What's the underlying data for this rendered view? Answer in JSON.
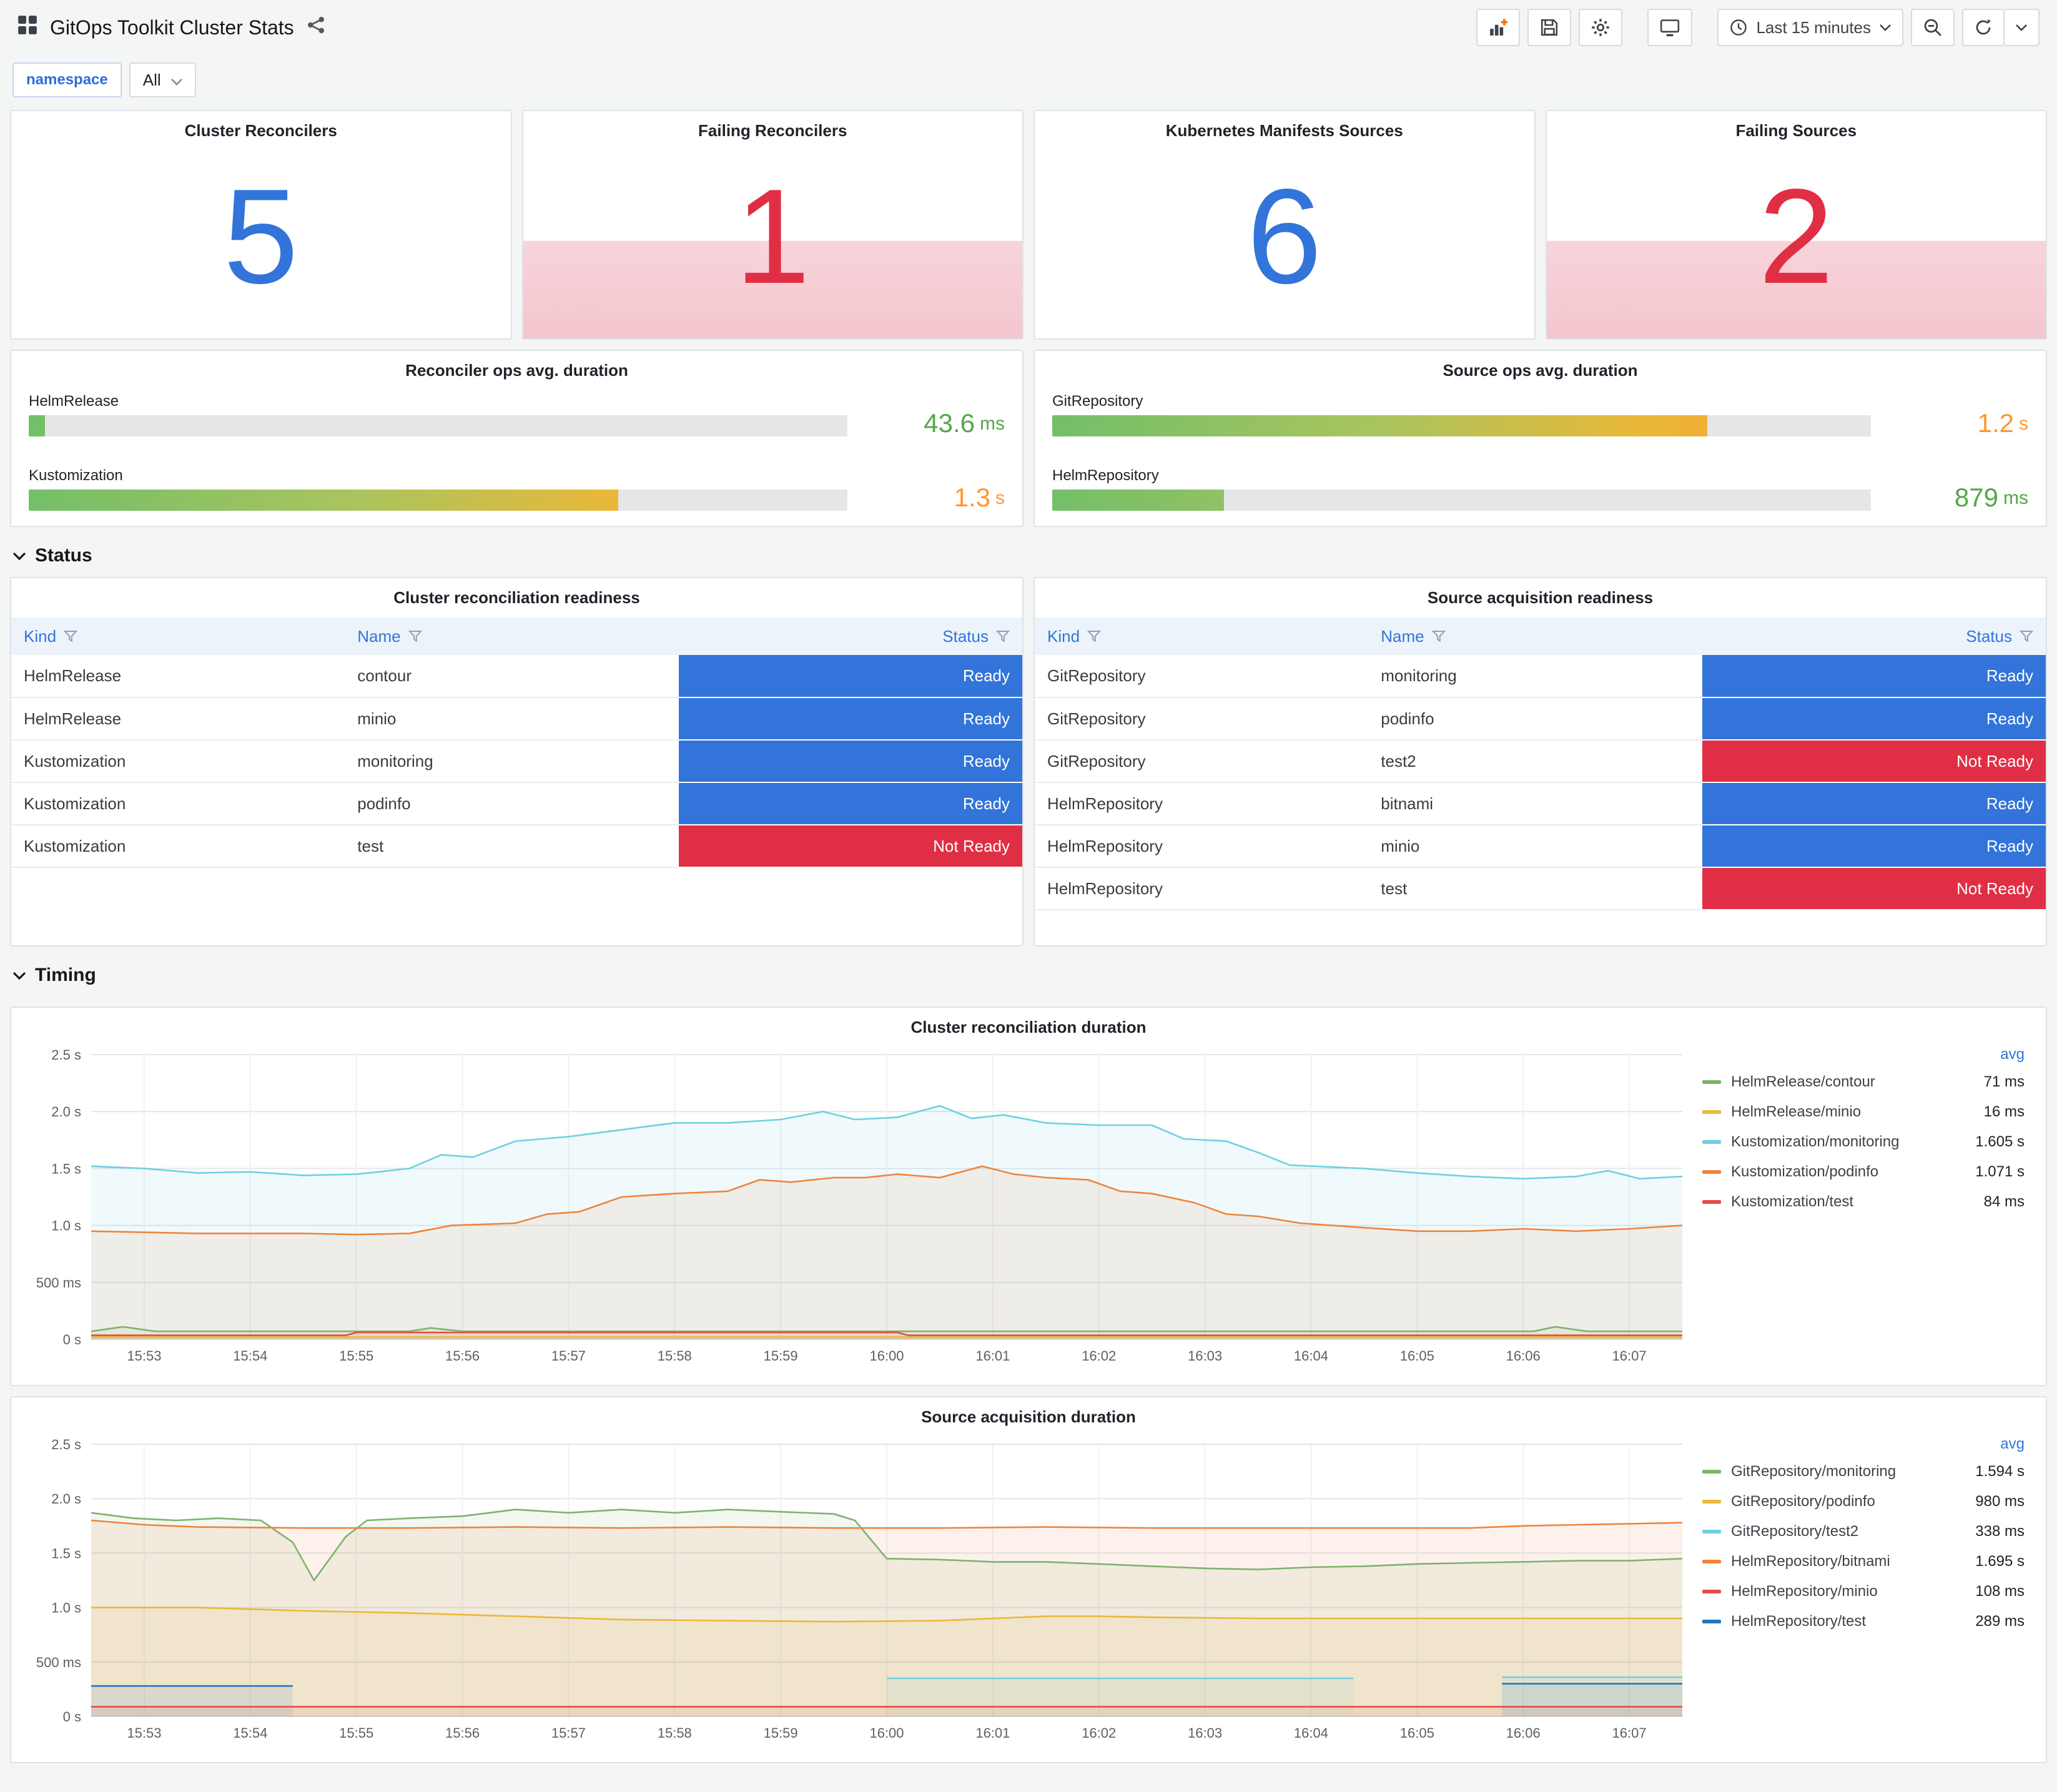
{
  "header": {
    "title": "GitOps Toolkit Cluster Stats",
    "time_range": "Last 15 minutes"
  },
  "variables": {
    "label": "namespace",
    "value": "All"
  },
  "icons": {
    "apps-icon": "grid",
    "share-icon": "share-nodes",
    "add-panel-icon": "graph-plus",
    "save-icon": "floppy-disk",
    "settings-icon": "gear",
    "tv-icon": "monitor",
    "clock-icon": "clock",
    "caret-down-icon": "chevron-down",
    "zoom-out-icon": "magnifier-minus",
    "refresh-icon": "circular-arrow",
    "filter-icon": "funnel",
    "collapse-icon": "chevron-down"
  },
  "rows": {
    "status": "Status",
    "timing": "Timing"
  },
  "stats": [
    {
      "title": "Cluster Reconcilers",
      "value": "5",
      "color": "#3274D9",
      "alert": false
    },
    {
      "title": "Failing Reconcilers",
      "value": "1",
      "color": "#E02F44",
      "alert": true
    },
    {
      "title": "Kubernetes Manifests Sources",
      "value": "6",
      "color": "#3274D9",
      "alert": false
    },
    {
      "title": "Failing Sources",
      "value": "2",
      "color": "#E02F44",
      "alert": true
    }
  ],
  "gauges": [
    {
      "title": "Reconciler ops avg. duration",
      "bars": [
        {
          "label": "HelmRelease",
          "value": "43.6",
          "unit": "ms",
          "percent": 2,
          "value_color": "#56A64B"
        },
        {
          "label": "Kustomization",
          "value": "1.3",
          "unit": "s",
          "percent": 72,
          "value_color": "#FF9830"
        }
      ]
    },
    {
      "title": "Source ops avg. duration",
      "bars": [
        {
          "label": "GitRepository",
          "value": "1.2",
          "unit": "s",
          "percent": 80,
          "value_color": "#FF9830"
        },
        {
          "label": "HelmRepository",
          "value": "879",
          "unit": "ms",
          "percent": 21,
          "value_color": "#56A64B"
        }
      ]
    }
  ],
  "status_colors": {
    "Ready": "#3274D9",
    "Not Ready": "#E02F44"
  },
  "tables": [
    {
      "title": "Cluster reconciliation readiness",
      "columns": [
        "Kind",
        "Name",
        "Status"
      ],
      "rows": [
        {
          "kind": "HelmRelease",
          "name": "contour",
          "status": "Ready"
        },
        {
          "kind": "HelmRelease",
          "name": "minio",
          "status": "Ready"
        },
        {
          "kind": "Kustomization",
          "name": "monitoring",
          "status": "Ready"
        },
        {
          "kind": "Kustomization",
          "name": "podinfo",
          "status": "Ready"
        },
        {
          "kind": "Kustomization",
          "name": "test",
          "status": "Not Ready"
        }
      ]
    },
    {
      "title": "Source acquisition readiness",
      "columns": [
        "Kind",
        "Name",
        "Status"
      ],
      "rows": [
        {
          "kind": "GitRepository",
          "name": "monitoring",
          "status": "Ready"
        },
        {
          "kind": "GitRepository",
          "name": "podinfo",
          "status": "Ready"
        },
        {
          "kind": "GitRepository",
          "name": "test2",
          "status": "Not Ready"
        },
        {
          "kind": "HelmRepository",
          "name": "bitnami",
          "status": "Ready"
        },
        {
          "kind": "HelmRepository",
          "name": "minio",
          "status": "Ready"
        },
        {
          "kind": "HelmRepository",
          "name": "test",
          "status": "Not Ready"
        }
      ]
    }
  ],
  "chart_data": [
    {
      "type": "line",
      "title": "Cluster reconciliation duration",
      "legend_header": "avg",
      "ylim": [
        0,
        2.5
      ],
      "x_range_minutes": [
        0,
        15
      ],
      "x_ticks": [
        "15:53",
        "15:54",
        "15:55",
        "15:56",
        "15:57",
        "15:58",
        "15:59",
        "16:00",
        "16:01",
        "16:02",
        "16:03",
        "16:04",
        "16:05",
        "16:06",
        "16:07"
      ],
      "y_ticks": [
        {
          "v": 0,
          "label": "0 s"
        },
        {
          "v": 0.5,
          "label": "500 ms"
        },
        {
          "v": 1.0,
          "label": "1.0 s"
        },
        {
          "v": 1.5,
          "label": "1.5 s"
        },
        {
          "v": 2.0,
          "label": "2.0 s"
        },
        {
          "v": 2.5,
          "label": "2.5 s"
        }
      ],
      "series": [
        {
          "name": "HelmRelease/contour",
          "avg": "71 ms",
          "color": "#7EB26D",
          "points": [
            [
              0,
              0.07
            ],
            [
              0.3,
              0.11
            ],
            [
              0.6,
              0.07
            ],
            [
              3,
              0.07
            ],
            [
              3.2,
              0.1
            ],
            [
              3.5,
              0.07
            ],
            [
              9,
              0.07
            ],
            [
              13.6,
              0.07
            ],
            [
              13.8,
              0.11
            ],
            [
              14.1,
              0.07
            ],
            [
              15,
              0.07
            ]
          ]
        },
        {
          "name": "HelmRelease/minio",
          "avg": "16 ms",
          "color": "#EAB839",
          "points": [
            [
              0,
              0.02
            ],
            [
              15,
              0.02
            ]
          ]
        },
        {
          "name": "Kustomization/monitoring",
          "avg": "1.605 s",
          "color": "#6ED0E0",
          "points": [
            [
              0,
              1.52
            ],
            [
              0.5,
              1.5
            ],
            [
              1,
              1.46
            ],
            [
              1.5,
              1.47
            ],
            [
              2,
              1.44
            ],
            [
              2.5,
              1.45
            ],
            [
              3,
              1.5
            ],
            [
              3.3,
              1.62
            ],
            [
              3.6,
              1.6
            ],
            [
              4,
              1.74
            ],
            [
              4.5,
              1.78
            ],
            [
              5,
              1.84
            ],
            [
              5.5,
              1.9
            ],
            [
              6,
              1.9
            ],
            [
              6.5,
              1.93
            ],
            [
              6.9,
              2.0
            ],
            [
              7.2,
              1.93
            ],
            [
              7.6,
              1.95
            ],
            [
              8,
              2.05
            ],
            [
              8.3,
              1.94
            ],
            [
              8.6,
              1.97
            ],
            [
              9,
              1.9
            ],
            [
              9.5,
              1.88
            ],
            [
              10,
              1.88
            ],
            [
              10.3,
              1.76
            ],
            [
              10.7,
              1.74
            ],
            [
              11,
              1.64
            ],
            [
              11.3,
              1.53
            ],
            [
              12,
              1.5
            ],
            [
              12.5,
              1.46
            ],
            [
              13,
              1.43
            ],
            [
              13.5,
              1.41
            ],
            [
              14,
              1.43
            ],
            [
              14.3,
              1.48
            ],
            [
              14.6,
              1.41
            ],
            [
              15,
              1.43
            ]
          ]
        },
        {
          "name": "Kustomization/podinfo",
          "avg": "1.071 s",
          "color": "#EF843C",
          "points": [
            [
              0,
              0.95
            ],
            [
              1,
              0.93
            ],
            [
              2,
              0.93
            ],
            [
              2.5,
              0.92
            ],
            [
              3,
              0.93
            ],
            [
              3.4,
              1.0
            ],
            [
              4,
              1.02
            ],
            [
              4.3,
              1.1
            ],
            [
              4.6,
              1.12
            ],
            [
              5,
              1.25
            ],
            [
              5.5,
              1.28
            ],
            [
              6,
              1.3
            ],
            [
              6.3,
              1.4
            ],
            [
              6.6,
              1.38
            ],
            [
              7,
              1.42
            ],
            [
              7.3,
              1.42
            ],
            [
              7.6,
              1.45
            ],
            [
              8,
              1.42
            ],
            [
              8.4,
              1.52
            ],
            [
              8.7,
              1.45
            ],
            [
              9,
              1.42
            ],
            [
              9.4,
              1.4
            ],
            [
              9.7,
              1.3
            ],
            [
              10,
              1.28
            ],
            [
              10.4,
              1.2
            ],
            [
              10.7,
              1.1
            ],
            [
              11,
              1.08
            ],
            [
              11.4,
              1.02
            ],
            [
              12,
              0.98
            ],
            [
              12.5,
              0.95
            ],
            [
              13,
              0.95
            ],
            [
              13.5,
              0.97
            ],
            [
              14,
              0.95
            ],
            [
              14.5,
              0.97
            ],
            [
              15,
              1.0
            ]
          ]
        },
        {
          "name": "Kustomization/test",
          "avg": "84 ms",
          "color": "#E24D42",
          "points": [
            [
              0,
              0.035
            ],
            [
              2.4,
              0.035
            ],
            [
              2.5,
              0.06
            ],
            [
              7.6,
              0.06
            ],
            [
              7.7,
              0.035
            ],
            [
              15,
              0.035
            ]
          ]
        }
      ]
    },
    {
      "type": "line",
      "title": "Source acquisition duration",
      "legend_header": "avg",
      "ylim": [
        0,
        2.5
      ],
      "x_range_minutes": [
        0,
        15
      ],
      "x_ticks": [
        "15:53",
        "15:54",
        "15:55",
        "15:56",
        "15:57",
        "15:58",
        "15:59",
        "16:00",
        "16:01",
        "16:02",
        "16:03",
        "16:04",
        "16:05",
        "16:06",
        "16:07"
      ],
      "y_ticks": [
        {
          "v": 0,
          "label": "0 s"
        },
        {
          "v": 0.5,
          "label": "500 ms"
        },
        {
          "v": 1.0,
          "label": "1.0 s"
        },
        {
          "v": 1.5,
          "label": "1.5 s"
        },
        {
          "v": 2.0,
          "label": "2.0 s"
        },
        {
          "v": 2.5,
          "label": "2.5 s"
        }
      ],
      "series": [
        {
          "name": "GitRepository/monitoring",
          "avg": "1.594 s",
          "color": "#7EB26D",
          "points": [
            [
              0,
              1.87
            ],
            [
              0.4,
              1.82
            ],
            [
              0.8,
              1.8
            ],
            [
              1.2,
              1.82
            ],
            [
              1.6,
              1.8
            ],
            [
              1.9,
              1.6
            ],
            [
              2.1,
              1.25
            ],
            [
              2.4,
              1.65
            ],
            [
              2.6,
              1.8
            ],
            [
              3,
              1.82
            ],
            [
              3.5,
              1.84
            ],
            [
              4,
              1.9
            ],
            [
              4.5,
              1.87
            ],
            [
              5,
              1.9
            ],
            [
              5.5,
              1.87
            ],
            [
              6,
              1.9
            ],
            [
              6.5,
              1.88
            ],
            [
              7,
              1.86
            ],
            [
              7.2,
              1.8
            ],
            [
              7.5,
              1.45
            ],
            [
              8,
              1.44
            ],
            [
              8.5,
              1.42
            ],
            [
              9,
              1.42
            ],
            [
              9.5,
              1.4
            ],
            [
              10,
              1.38
            ],
            [
              10.5,
              1.36
            ],
            [
              11,
              1.35
            ],
            [
              11.5,
              1.37
            ],
            [
              12,
              1.38
            ],
            [
              12.5,
              1.4
            ],
            [
              13,
              1.41
            ],
            [
              13.5,
              1.42
            ],
            [
              14,
              1.43
            ],
            [
              14.5,
              1.43
            ],
            [
              15,
              1.45
            ]
          ]
        },
        {
          "name": "GitRepository/podinfo",
          "avg": "980 ms",
          "color": "#EAB839",
          "points": [
            [
              0,
              1.0
            ],
            [
              1,
              1.0
            ],
            [
              2,
              0.97
            ],
            [
              3,
              0.95
            ],
            [
              4,
              0.92
            ],
            [
              5,
              0.89
            ],
            [
              6,
              0.88
            ],
            [
              7,
              0.87
            ],
            [
              8,
              0.88
            ],
            [
              8.5,
              0.9
            ],
            [
              9,
              0.92
            ],
            [
              9.5,
              0.92
            ],
            [
              10,
              0.91
            ],
            [
              11,
              0.9
            ],
            [
              12,
              0.9
            ],
            [
              13,
              0.9
            ],
            [
              14,
              0.9
            ],
            [
              15,
              0.9
            ]
          ]
        },
        {
          "name": "GitRepository/test2",
          "avg": "338 ms",
          "color": "#6ED0E0",
          "points": [
            [
              7.5,
              0.35
            ],
            [
              9,
              0.35
            ],
            [
              10,
              0.35
            ],
            [
              11.9,
              0.35
            ],
            null,
            [
              13.3,
              0.36
            ],
            [
              14,
              0.36
            ],
            [
              15,
              0.36
            ]
          ]
        },
        {
          "name": "HelmRepository/bitnami",
          "avg": "1.695 s",
          "color": "#EF843C",
          "points": [
            [
              0,
              1.8
            ],
            [
              0.5,
              1.76
            ],
            [
              1,
              1.74
            ],
            [
              2,
              1.73
            ],
            [
              3,
              1.73
            ],
            [
              4,
              1.74
            ],
            [
              5,
              1.73
            ],
            [
              6,
              1.74
            ],
            [
              7,
              1.73
            ],
            [
              8,
              1.73
            ],
            [
              9,
              1.74
            ],
            [
              10,
              1.73
            ],
            [
              11,
              1.73
            ],
            [
              12,
              1.73
            ],
            [
              13,
              1.73
            ],
            [
              13.5,
              1.75
            ],
            [
              14,
              1.76
            ],
            [
              14.5,
              1.77
            ],
            [
              15,
              1.78
            ]
          ]
        },
        {
          "name": "HelmRepository/minio",
          "avg": "108 ms",
          "color": "#E24D42",
          "points": [
            [
              0,
              0.09
            ],
            [
              15,
              0.09
            ]
          ]
        },
        {
          "name": "HelmRepository/test",
          "avg": "289 ms",
          "color": "#1F78C1",
          "points": [
            [
              0,
              0.28
            ],
            [
              1.9,
              0.28
            ],
            null,
            [
              13.3,
              0.3
            ],
            [
              15,
              0.3
            ]
          ]
        }
      ]
    }
  ]
}
